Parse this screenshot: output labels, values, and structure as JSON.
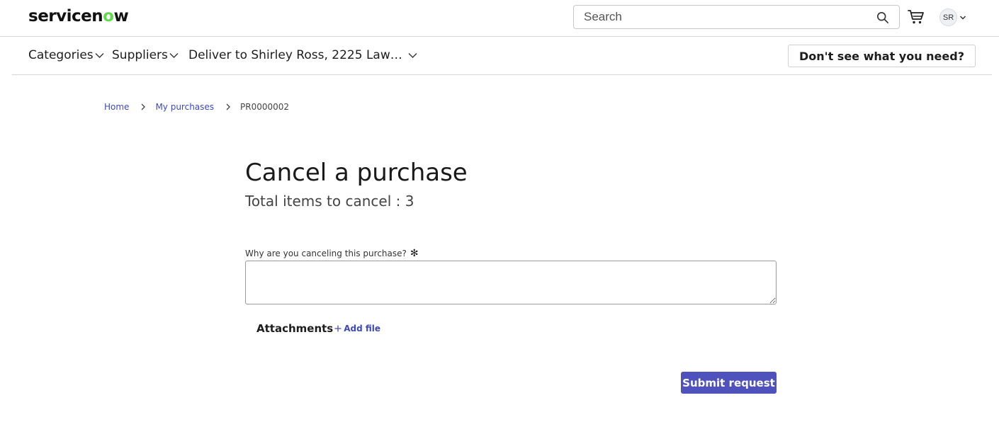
{
  "header": {
    "logo_text": "servicenow",
    "search_placeholder": "Search",
    "avatar_initials": "SR"
  },
  "nav": {
    "categories_label": "Categories",
    "suppliers_label": "Suppliers",
    "deliver_label": "Deliver to Shirley Ross, 2225 Law…",
    "dont_see_label": "Don't see what you need?"
  },
  "breadcrumb": {
    "home": "Home",
    "my_purchases": "My purchases",
    "current": "PR0000002"
  },
  "main": {
    "title": "Cancel a purchase",
    "subtitle": "Total items to cancel : 3",
    "reason_label": "Why are you canceling this purchase?",
    "reason_value": "",
    "attachments_title": "Attachments",
    "add_file_label": "Add file",
    "submit_label": "Submit request"
  },
  "colors": {
    "accent": "#4f52bd",
    "link": "#3d4ab8",
    "logo_o": "#62d84e"
  }
}
